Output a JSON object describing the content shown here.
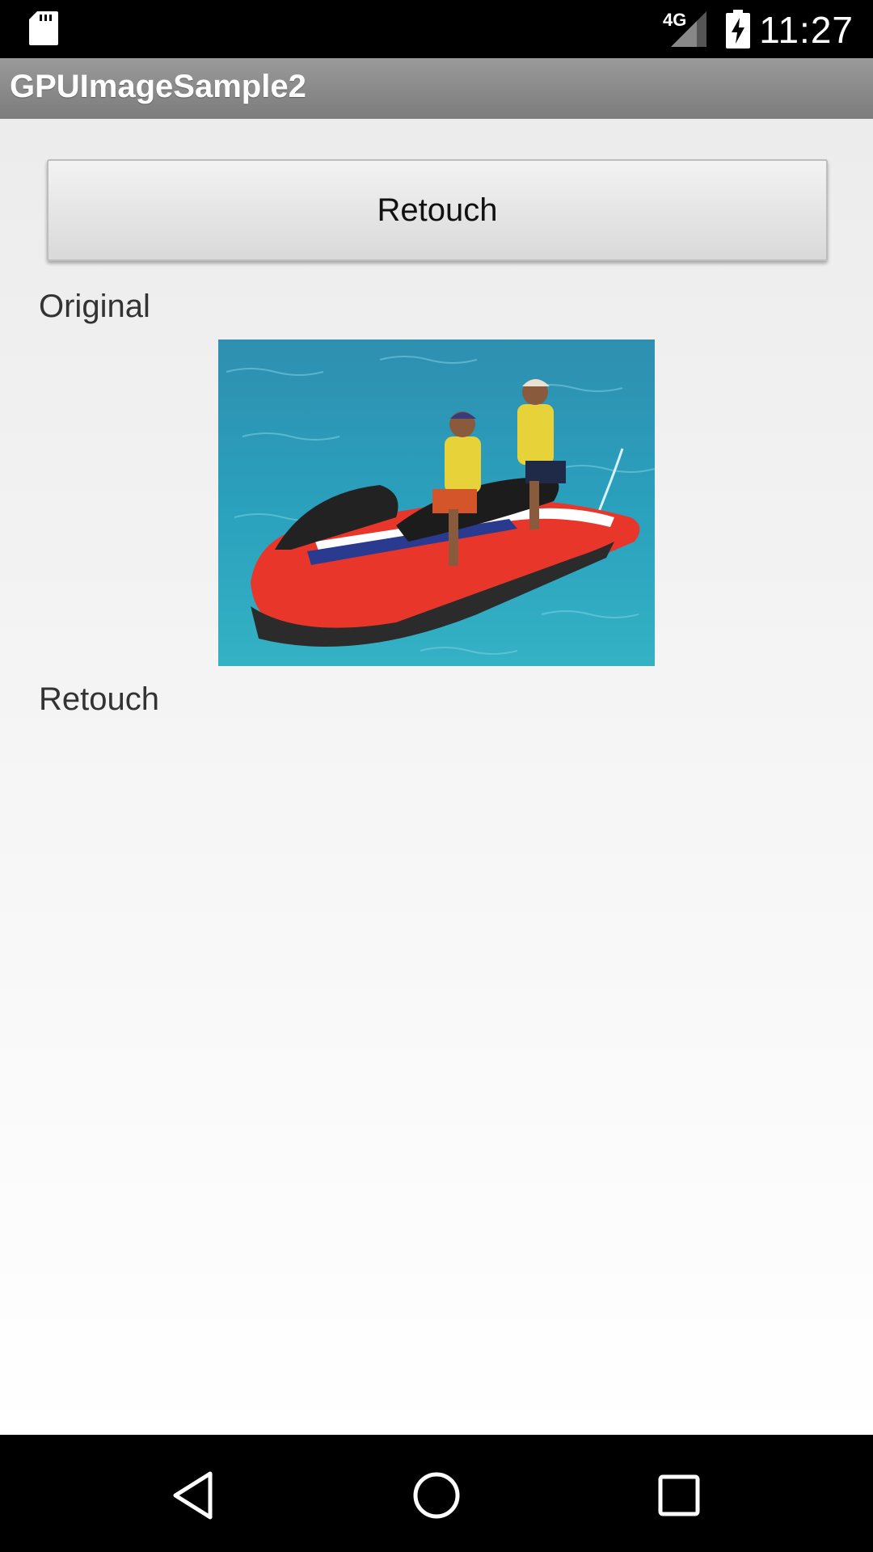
{
  "status_bar": {
    "network": "4G",
    "time": "11:27",
    "icons": [
      "sd-card-icon",
      "signal-icon",
      "battery-charging-icon"
    ]
  },
  "app_bar": {
    "title": "GPUImageSample2"
  },
  "main": {
    "retouch_button_label": "Retouch",
    "original_label": "Original",
    "retouch_label": "Retouch",
    "original_image": "jet-ski-photo"
  },
  "nav_bar": {
    "icons": [
      "back-icon",
      "home-icon",
      "recents-icon"
    ]
  },
  "colors": {
    "app_bar": "#8a8a8a",
    "background": "#efefef",
    "button": "#e2e2e2"
  }
}
